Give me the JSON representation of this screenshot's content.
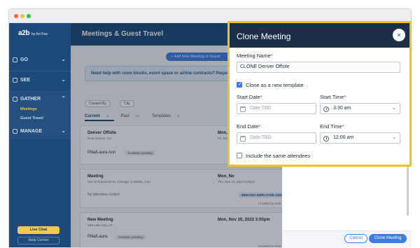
{
  "sidebar": {
    "logo": "a2b",
    "logo_sub": "by AmTrav",
    "items": [
      {
        "label": "GO",
        "chevron": "⌄"
      },
      {
        "label": "SEE",
        "chevron": "⌄"
      },
      {
        "label": "GATHER",
        "chevron": "⌃"
      },
      {
        "label": "MANAGE",
        "chevron": "⌄"
      }
    ],
    "gather_sub": [
      "Meetings",
      "Guest Travel"
    ],
    "live_chat": "Live Chat",
    "help_center": "Help Center"
  },
  "header": {
    "title": "Meetings & Guest Travel"
  },
  "content": {
    "add_button": "+ Add New Meeting or Guest",
    "notice": "Need help with room blocks, event space or airline contracts? Request S",
    "filters": [
      "Created By",
      "City"
    ],
    "tabs": [
      {
        "label": "Current",
        "count": "3"
      },
      {
        "label": "Past",
        "count": "62"
      },
      {
        "label": "Templates",
        "count": "8"
      }
    ],
    "cards": [
      {
        "name": "Denver Offsite",
        "addr": "Near Denver, CO",
        "person": "Pilla/Laura Ann",
        "status": "invitation pending",
        "date": "Mon, No",
        "date_sub": "Fri, Nov"
      },
      {
        "name": "Meeting",
        "addr": "250 W Roosevelt St, Chicago, IL 60606, USA",
        "no_attendees": "No attendees invited",
        "date": "Mon, No",
        "date_sub": "Thu, Nov 23, 2023 5:00pm",
        "badge": "MEETING EMPLOYEE AND",
        "created_by": "Created by Amtr"
      },
      {
        "name": "New Meeting",
        "addr": "Salt Lake City, UT",
        "person": "Pilla/Laura",
        "status": "invitation pending",
        "date": "Mon, Nov 20, 2023 3:00pm",
        "created_by": "Created by Amtr"
      }
    ]
  },
  "panel": {
    "cancel": "Cancel",
    "clone": "Clone Meeting"
  },
  "modal": {
    "title": "Clone Meeting",
    "close_icon": "×",
    "meeting_name_label": "Meeting Name",
    "meeting_name_value": "CLONE Denver Offsite",
    "clone_template_label": "Clone as a new template",
    "clone_template_checked": true,
    "start_date_label": "Start Date",
    "start_date_placeholder": "Date TBD",
    "start_time_label": "Start Time",
    "start_time_value": "3:30 am",
    "end_date_label": "End Date",
    "end_date_placeholder": "Date TBD",
    "end_time_label": "End Time",
    "end_time_value": "12:00 am",
    "same_attendees_label": "Include the same attendees",
    "same_attendees_checked": false,
    "required_mark": "*"
  },
  "colors": {
    "sidebar": "#1d4a7a",
    "modal_header": "#1b2f48",
    "highlight": "#f2c21b",
    "accent": "#3d7de0"
  }
}
